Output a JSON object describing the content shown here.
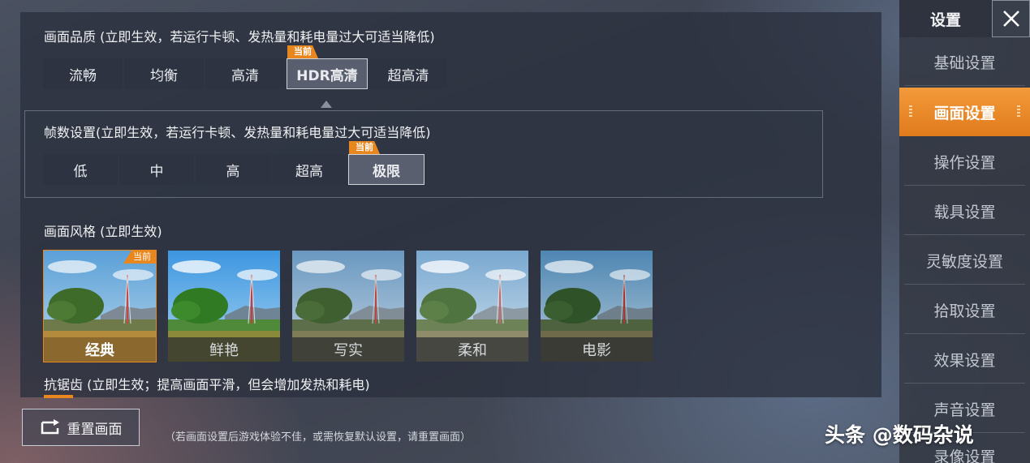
{
  "quality": {
    "title": "画面品质 (立即生效，若运行卡顿、发热量和耗电量过大可适当降低)",
    "options": [
      "流畅",
      "均衡",
      "高清",
      "HDR高清",
      "超高清"
    ],
    "current_tag": "当前"
  },
  "framerate": {
    "title": "帧数设置(立即生效，若运行卡顿、发热量和耗电量过大可适当降低)",
    "options": [
      "低",
      "中",
      "高",
      "超高",
      "极限"
    ],
    "current_tag": "当前"
  },
  "style": {
    "title": "画面风格 (立即生效)",
    "options": [
      "经典",
      "鲜艳",
      "写实",
      "柔和",
      "电影"
    ],
    "current_tag": "当前"
  },
  "antialias": {
    "title": "抗锯齿 (立即生效；提高画面平滑，但会增加发热和耗电)"
  },
  "footer": {
    "reset_label": "重置画面",
    "hint": "（若画面设置后游戏体验不佳，或需恢复默认设置，请重置画面）"
  },
  "watermark": "头条 @数码杂说",
  "sidebar": {
    "title": "设置",
    "items": [
      "基础设置",
      "画面设置",
      "操作设置",
      "载具设置",
      "灵敏度设置",
      "拾取设置",
      "效果设置",
      "声音设置",
      "录像设置"
    ]
  },
  "colors": {
    "accent": "#e8871e",
    "sidebar_active": "#f39a3a"
  }
}
